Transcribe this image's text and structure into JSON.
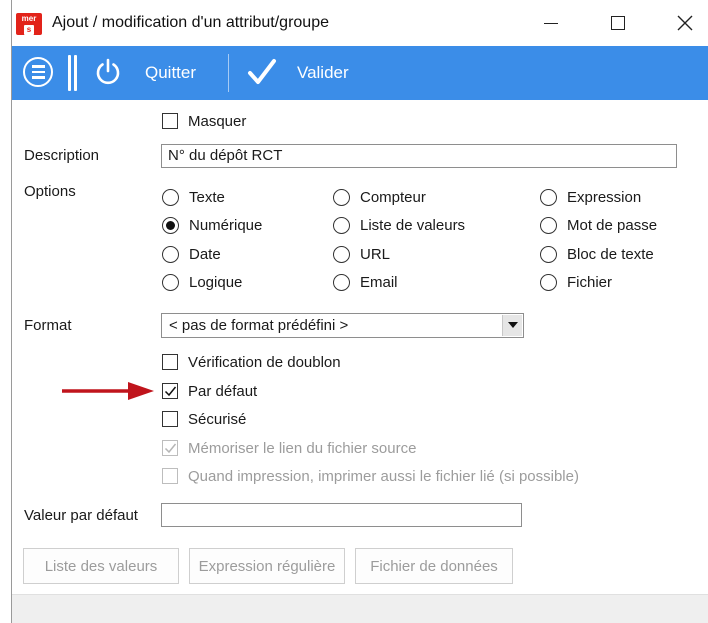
{
  "window": {
    "title": "Ajout / modification d'un attribut/groupe",
    "logo_text_top": "mer",
    "logo_text_bottom": "s",
    "controls": [
      "minimize-icon",
      "maximize-icon",
      "close-icon"
    ]
  },
  "toolbar": {
    "menu_icon": "menu-icon",
    "quit_icon": "power-icon",
    "quit_label": "Quitter",
    "validate_icon": "checkmark-icon",
    "validate_label": "Valider",
    "background_color": "#3b8de8"
  },
  "form": {
    "masquer": {
      "label": "Masquer",
      "checked": false
    },
    "description": {
      "label": "Description",
      "value": "N° du dépôt RCT"
    },
    "options": {
      "label": "Options",
      "radios": [
        {
          "label": "Texte",
          "checked": false
        },
        {
          "label": "Numérique",
          "checked": true
        },
        {
          "label": "Date",
          "checked": false
        },
        {
          "label": "Logique",
          "checked": false
        },
        {
          "label": "Compteur",
          "checked": false
        },
        {
          "label": "Liste de valeurs",
          "checked": false
        },
        {
          "label": "URL",
          "checked": false
        },
        {
          "label": "Email",
          "checked": false
        },
        {
          "label": "Expression",
          "checked": false
        },
        {
          "label": "Mot de passe",
          "checked": false
        },
        {
          "label": "Bloc de texte",
          "checked": false
        },
        {
          "label": "Fichier",
          "checked": false
        }
      ]
    },
    "format": {
      "label": "Format",
      "selected": "< pas de format prédéfini >"
    },
    "checkboxes": [
      {
        "label": "Vérification de doublon",
        "checked": false,
        "enabled": true
      },
      {
        "label": "Par défaut",
        "checked": true,
        "enabled": true
      },
      {
        "label": "Sécurisé",
        "checked": false,
        "enabled": true
      },
      {
        "label": "Mémoriser le lien du fichier source",
        "checked": true,
        "enabled": false
      },
      {
        "label": "Quand impression, imprimer aussi le fichier lié (si possible)",
        "checked": false,
        "enabled": false
      }
    ],
    "default_value": {
      "label": "Valeur par défaut",
      "value": ""
    }
  },
  "buttons": {
    "liste": "Liste des valeurs",
    "expression": "Expression régulière",
    "fichier": "Fichier de données"
  },
  "annotation": {
    "arrow_color": "#c0141c"
  }
}
